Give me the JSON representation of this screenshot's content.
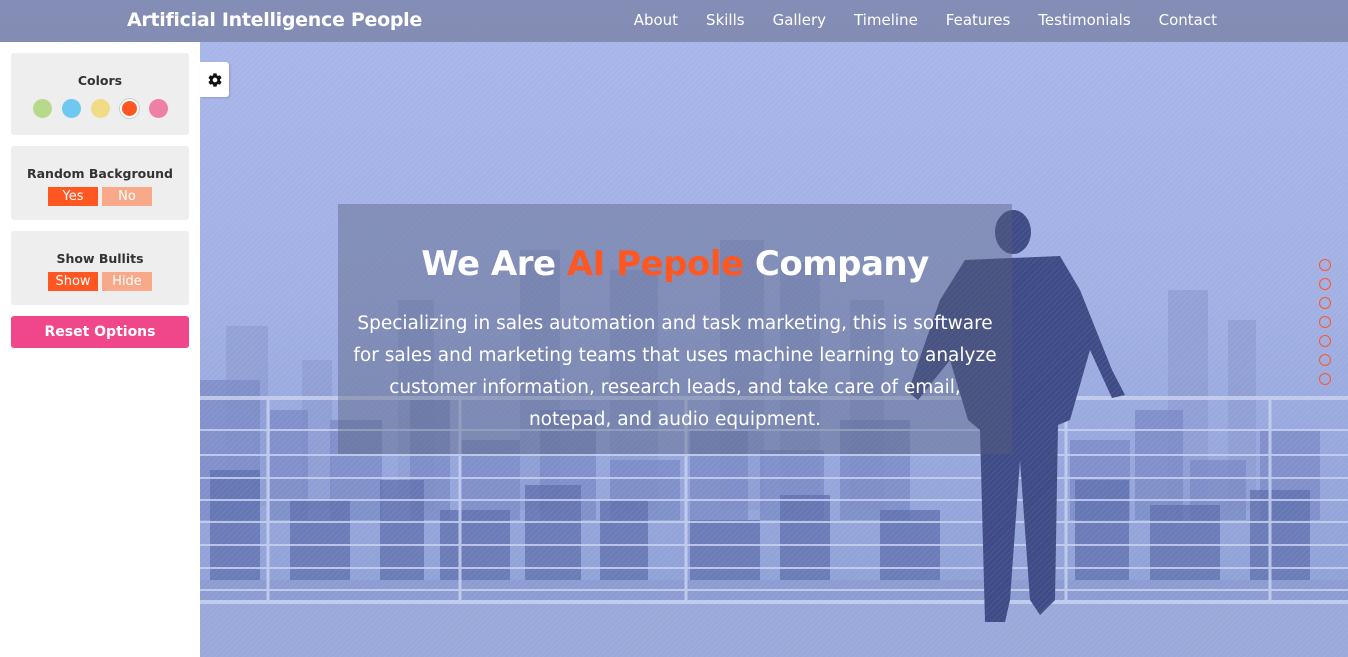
{
  "brand": "Artificial Intelligence People",
  "nav": [
    "About",
    "Skills",
    "Gallery",
    "Timeline",
    "Features",
    "Testimonials",
    "Contact"
  ],
  "settings": {
    "colors_title": "Colors",
    "colors": [
      "#b8d98c",
      "#6fc8ef",
      "#f1db86",
      "#ff5722",
      "#ef7fa7"
    ],
    "active_color": "#ff5722",
    "random_bg": {
      "title": "Random Background",
      "yes": "Yes",
      "no": "No"
    },
    "bullets": {
      "title": "Show Bullits",
      "show": "Show",
      "hide": "Hide"
    },
    "reset": "Reset Options"
  },
  "hero": {
    "title_prefix": "We Are",
    "title_accent": "AI Pepole",
    "title_suffix": "Company",
    "text": "Specializing in sales automation and task marketing, this is software for sales and marketing teams that uses machine learning to analyze customer information, research leads, and take care of email, notepad, and audio equipment."
  },
  "bullet_count": 7,
  "accent_color": "#ff5722",
  "icons": {
    "settings": "gear-icon"
  }
}
